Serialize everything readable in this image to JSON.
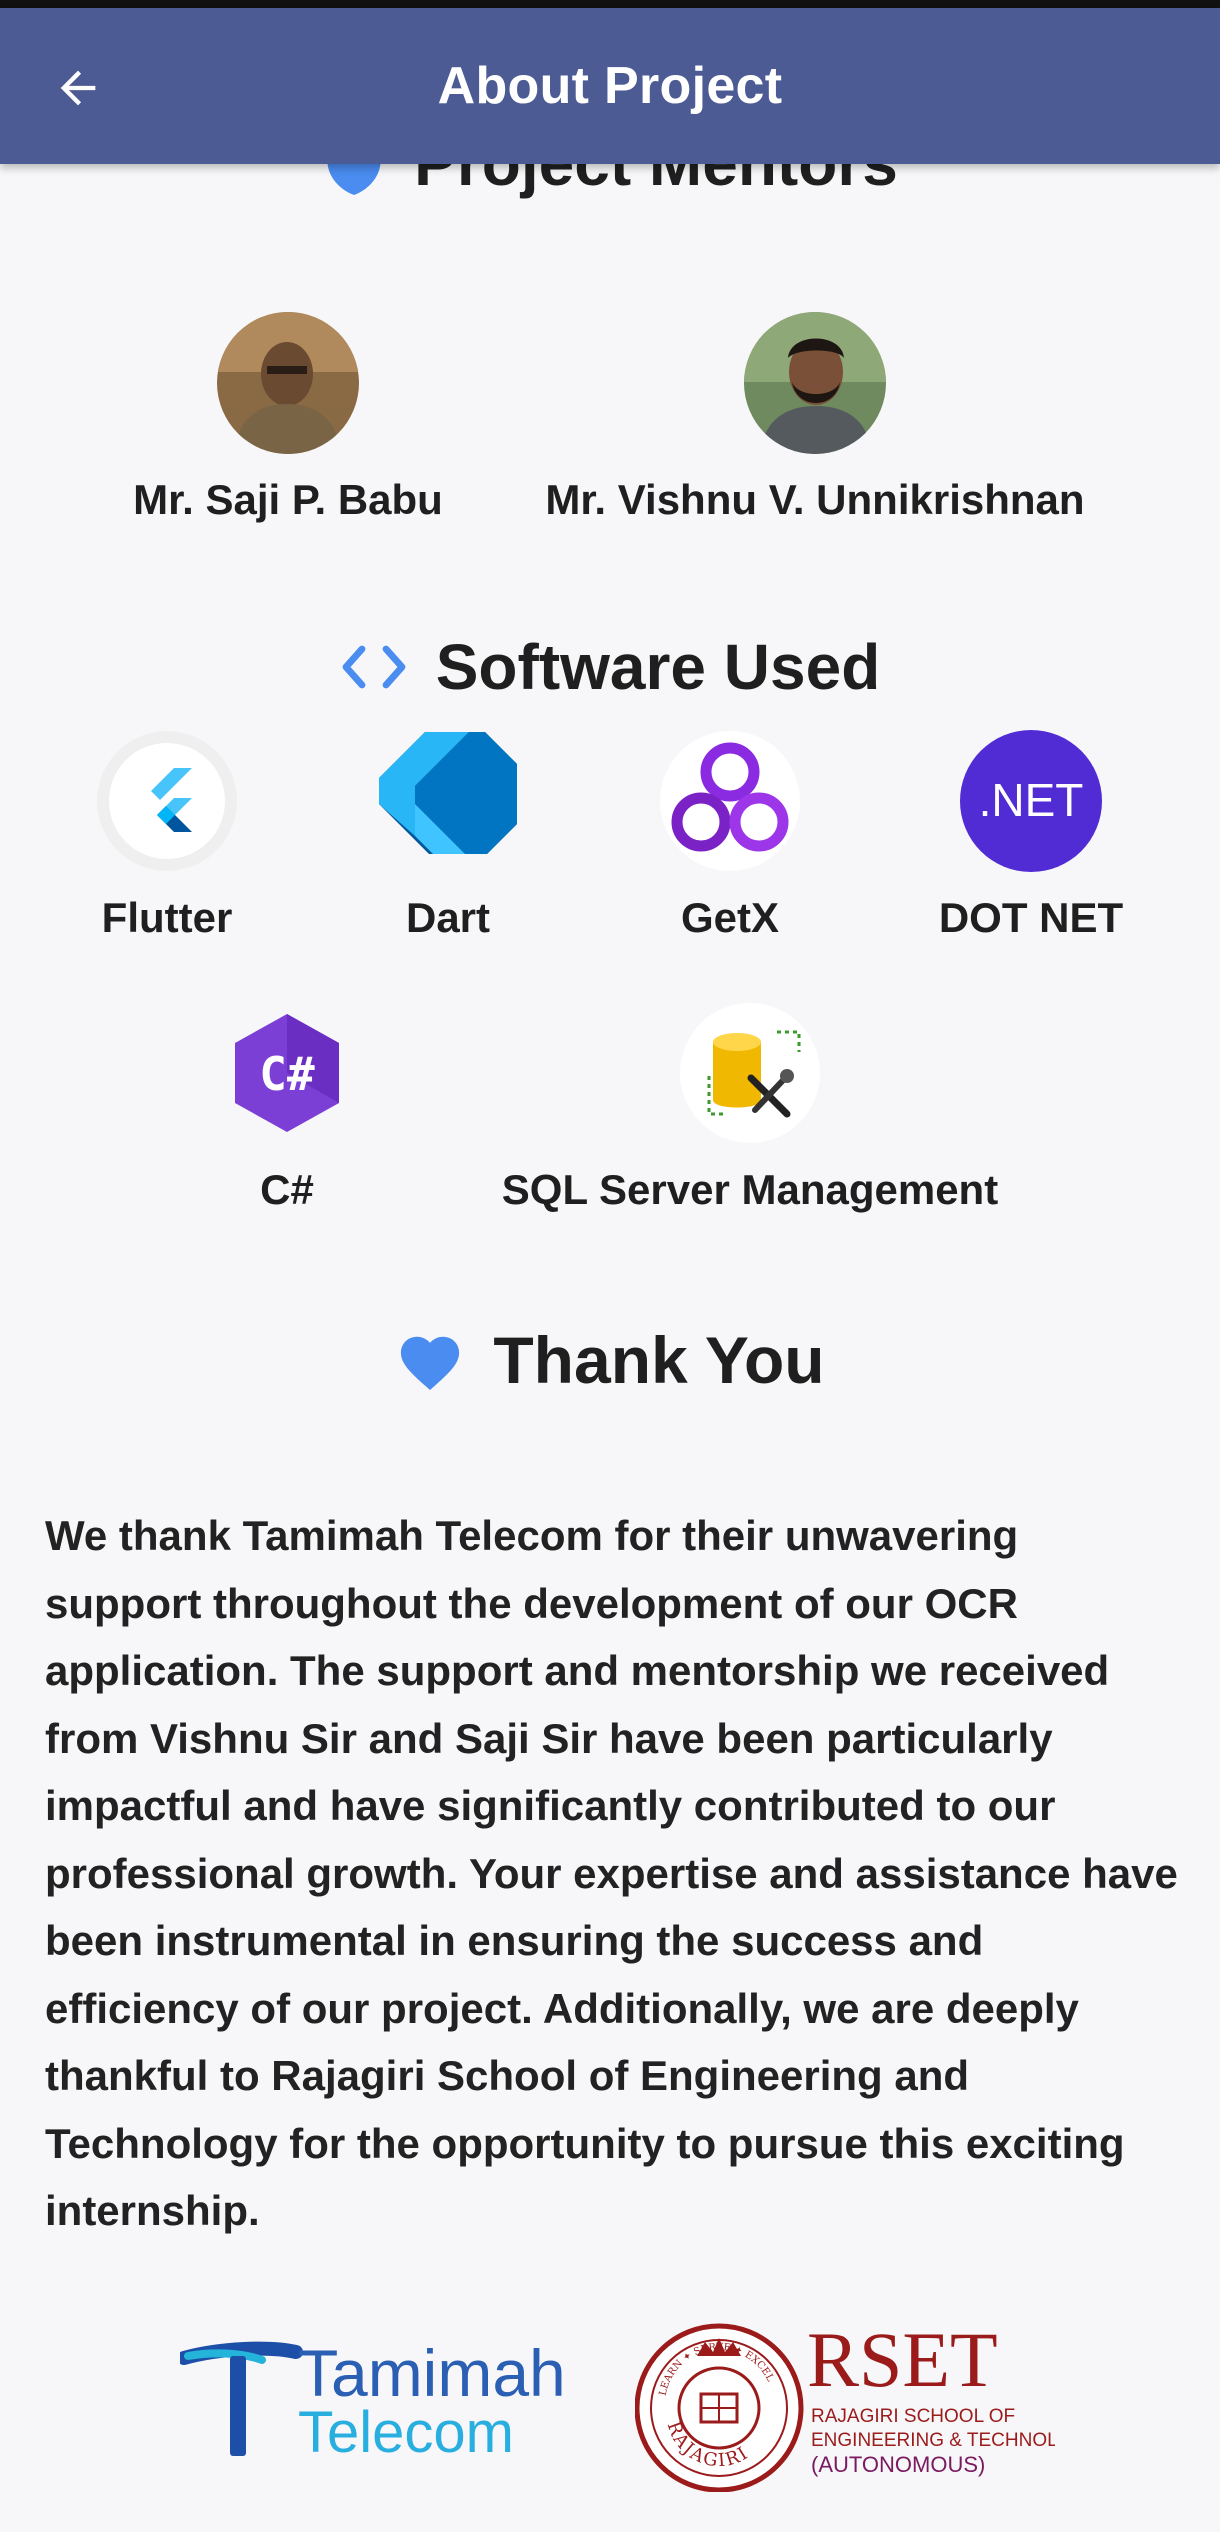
{
  "app_bar": {
    "title": "About Project",
    "back_icon": "arrow-left-icon"
  },
  "mentors": {
    "heading": "Project Mentors",
    "heading_icon": "shield-icon",
    "people": [
      {
        "name": "Mr. Saji P. Babu"
      },
      {
        "name": "Mr. Vishnu V. Unnikrishnan"
      }
    ]
  },
  "software": {
    "heading": "Software Used",
    "heading_icon": "code-icon",
    "items": [
      {
        "label": "Flutter",
        "icon": "flutter-icon"
      },
      {
        "label": "Dart",
        "icon": "dart-icon"
      },
      {
        "label": "GetX",
        "icon": "getx-icon"
      },
      {
        "label": "DOT NET",
        "icon": "dotnet-icon",
        "badge_text": ".NET"
      },
      {
        "label": "C#",
        "icon": "csharp-icon",
        "badge_text": "C#"
      },
      {
        "label": "SQL Server Management",
        "icon": "sql-server-icon"
      }
    ]
  },
  "thanks": {
    "heading": "Thank You",
    "heading_icon": "heart-icon",
    "body": "We thank Tamimah Telecom for their unwavering support throughout the development of our OCR application. The support and mentorship we received from Vishnu Sir and Saji Sir have been particularly impactful and have significantly contributed to our professional growth. Your expertise and assistance have been instrumental in ensuring the success and efficiency of our project. Additionally, we are deeply thankful to Rajagiri School of Engineering and Technology for the opportunity to pursue this exciting internship."
  },
  "logos": {
    "tamimah": {
      "line1": "Tamimah",
      "line2": "Telecom"
    },
    "rset": {
      "acronym": "RSET",
      "line1": "RAJAGIRI SCHOOL OF",
      "line2": "ENGINEERING & TECHNOLOGY",
      "line3": "(AUTONOMOUS)",
      "seal_top": "LEARN ✦ SERVE ✦ EXCEL",
      "seal_bottom": "RAJAGIRI"
    }
  },
  "colors": {
    "app_bar": "#4c5b94",
    "accent_blue": "#4a8cf0",
    "background": "#f7f7f9",
    "dotnet": "#512bd4",
    "csharp": "#7b3fd6",
    "getx": "#8a2be2",
    "rset_red": "#9b1b1b"
  }
}
